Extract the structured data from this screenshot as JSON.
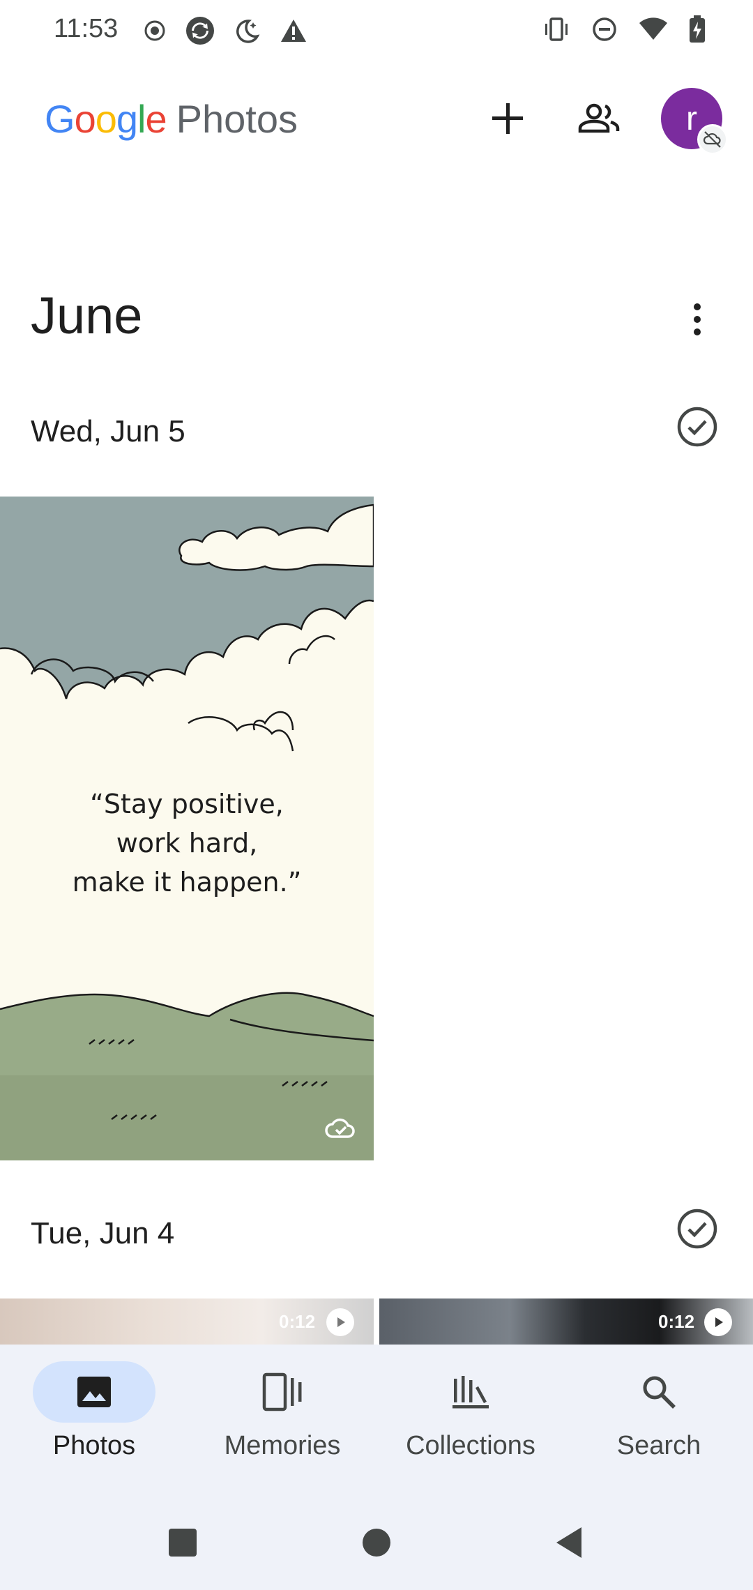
{
  "status_bar": {
    "time": "11:53",
    "left_icons": [
      "record-icon",
      "sync-icon",
      "night-mode-icon",
      "warning-icon"
    ],
    "right_icons": [
      "vibrate-icon",
      "do-not-disturb-icon",
      "wifi-icon",
      "battery-charging-icon"
    ]
  },
  "app_bar": {
    "logo_google": "Google",
    "logo_photos": "Photos",
    "add_icon": "plus-icon",
    "sharing_icon": "people-icon",
    "avatar_letter": "r",
    "avatar_color": "#7b2c9e",
    "avatar_badge_icon": "backup-off-icon"
  },
  "timeline": {
    "month": "June",
    "sections": [
      {
        "date": "Wed, Jun 5",
        "photo": {
          "quote_lines": [
            "“Stay positive,",
            "work hard,",
            "make it happen.”"
          ],
          "status_icon": "cloud-done-icon"
        }
      },
      {
        "date": "Tue, Jun 4",
        "thumbnails": [
          {
            "duration": "0:12",
            "icon": "play-icon"
          },
          {
            "duration": "0:12",
            "icon": "play-icon"
          }
        ]
      }
    ]
  },
  "bottom_nav": {
    "items": [
      {
        "label": "Photos",
        "icon": "photo-icon",
        "active": true
      },
      {
        "label": "Memories",
        "icon": "memories-icon",
        "active": false
      },
      {
        "label": "Collections",
        "icon": "collections-icon",
        "active": false
      },
      {
        "label": "Search",
        "icon": "search-icon",
        "active": false
      }
    ],
    "active_pill_color": "#d3e3fd"
  },
  "system_nav": {
    "buttons": [
      "recents-icon",
      "home-icon",
      "back-icon"
    ]
  }
}
